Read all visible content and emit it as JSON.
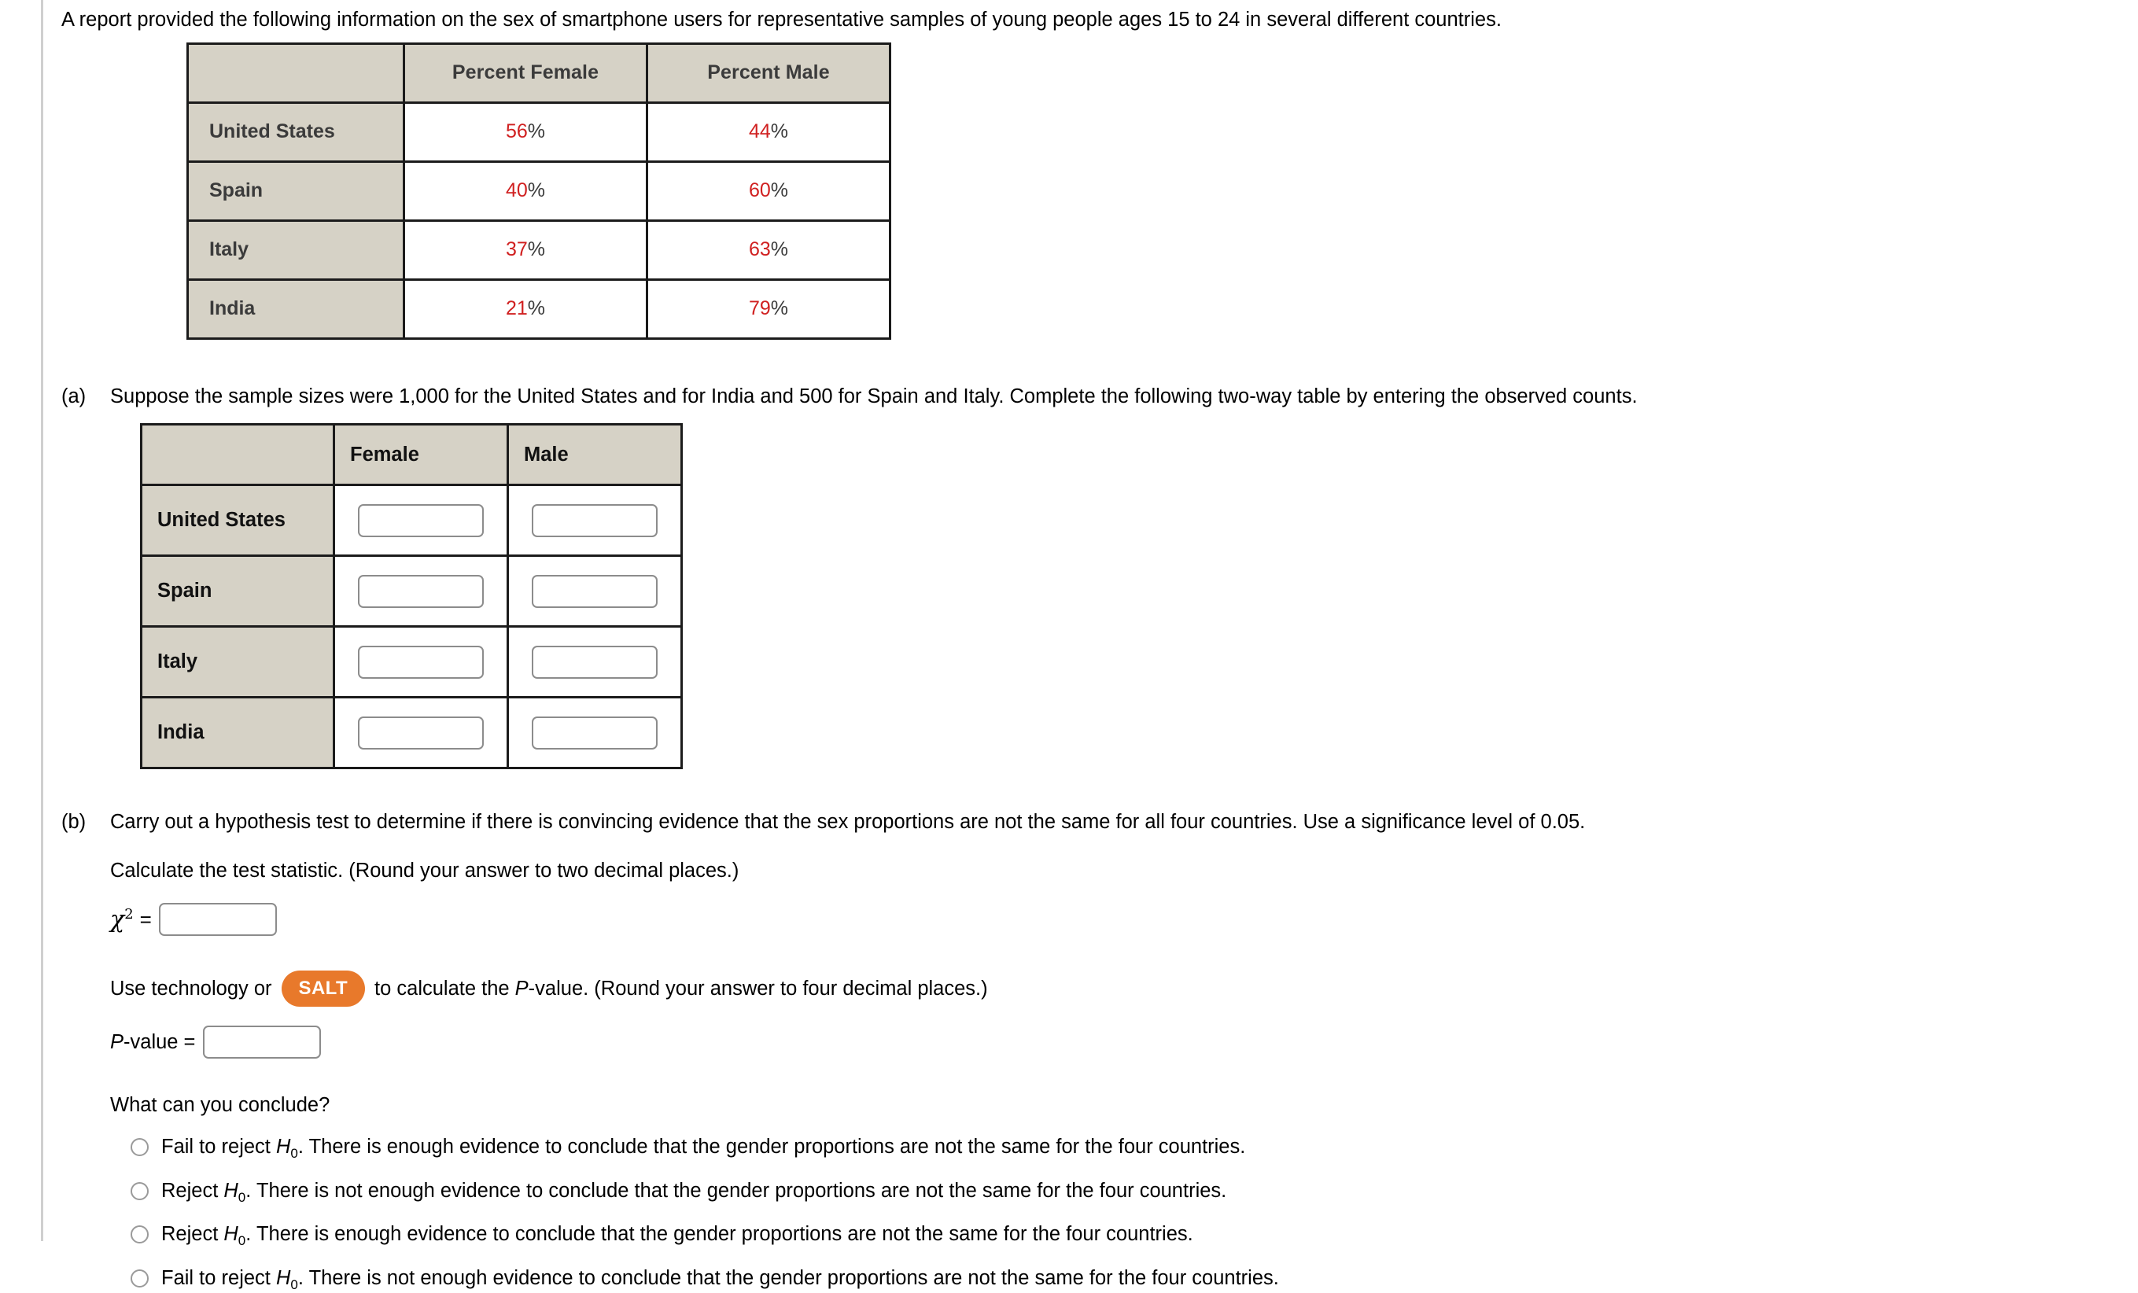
{
  "intro": "A report provided the following information on the sex of smartphone users for representative samples of young people ages 15 to 24 in several different countries.",
  "percent_table": {
    "corner": "",
    "columns": [
      "Percent Female",
      "Percent Male"
    ],
    "rows": [
      {
        "country": "United States",
        "female": "56",
        "male": "44"
      },
      {
        "country": "Spain",
        "female": "40",
        "male": "60"
      },
      {
        "country": "Italy",
        "female": "37",
        "male": "63"
      },
      {
        "country": "India",
        "female": "21",
        "male": "79"
      }
    ],
    "percent_symbol": "%",
    "value_color": "#d02020",
    "header_bg": "#d6d2c6"
  },
  "part_a": {
    "marker": "(a)",
    "text": "Suppose the sample sizes were 1,000 for the United States and for India and 500 for Spain and Italy. Complete the following two-way table by entering the observed counts.",
    "entry_table": {
      "corner": "",
      "columns": [
        "Female",
        "Male"
      ],
      "rows": [
        {
          "country": "United States",
          "female_value": "",
          "male_value": ""
        },
        {
          "country": "Spain",
          "female_value": "",
          "male_value": ""
        },
        {
          "country": "Italy",
          "female_value": "",
          "male_value": ""
        },
        {
          "country": "India",
          "female_value": "",
          "male_value": ""
        }
      ]
    }
  },
  "part_b": {
    "marker": "(b)",
    "text": "Carry out a hypothesis test to determine if there is convincing evidence that the sex proportions are not the same for all four countries. Use a significance level of 0.05.",
    "calc_instruction": "Calculate the test statistic. (Round your answer to two decimal places.)",
    "chi_label": "χ",
    "chi_exponent": "2",
    "equals": "=",
    "chi_value": "",
    "salt_prefix": "Use technology or",
    "salt_button": "SALT",
    "salt_suffix_1": "to calculate the",
    "salt_suffix_p": "P",
    "salt_suffix_2": "-value. (Round your answer to four decimal places.)",
    "pvalue_label_p": "P",
    "pvalue_label_rest": "-value  =",
    "pvalue_value": "",
    "conclude_question": "What can you conclude?",
    "options": [
      {
        "lead": "Fail to reject",
        "h": "H",
        "sub": "0",
        "rest": ". There is enough evidence to conclude that the gender proportions are not the same for the four countries.",
        "selected": false
      },
      {
        "lead": "Reject",
        "h": "H",
        "sub": "0",
        "rest": ". There is not enough evidence to conclude that the gender proportions are not the same for the four countries.",
        "selected": false
      },
      {
        "lead": "Reject",
        "h": "H",
        "sub": "0",
        "rest": ". There is enough evidence to conclude that the gender proportions are not the same for the four countries.",
        "selected": false
      },
      {
        "lead": "Fail to reject",
        "h": "H",
        "sub": "0",
        "rest": ". There is not enough evidence to conclude that the gender proportions are not the same for the four countries.",
        "selected": false
      }
    ]
  },
  "colors": {
    "accent_orange": "#e8792b",
    "table_header": "#d6d2c6",
    "value_red": "#d02020",
    "rule_gray": "#cfcfcf"
  }
}
